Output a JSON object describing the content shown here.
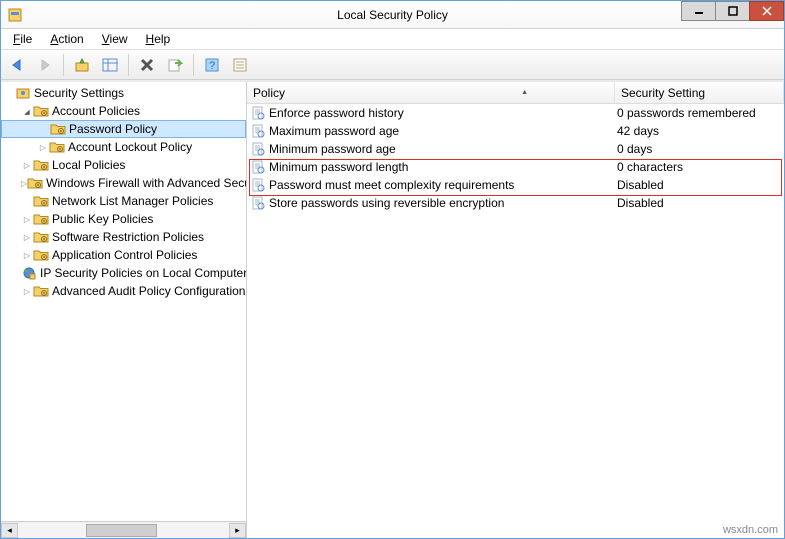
{
  "window": {
    "title": "Local Security Policy"
  },
  "menubar": {
    "file": "File",
    "action": "Action",
    "view": "View",
    "help": "Help"
  },
  "tree": {
    "root": "Security Settings",
    "items": [
      {
        "label": "Account Policies",
        "expander": "open",
        "indent": 1,
        "icon": "folder"
      },
      {
        "label": "Password Policy",
        "expander": "none",
        "indent": 2,
        "icon": "folder",
        "selected": true
      },
      {
        "label": "Account Lockout Policy",
        "expander": "closed",
        "indent": 2,
        "icon": "folder"
      },
      {
        "label": "Local Policies",
        "expander": "closed",
        "indent": 1,
        "icon": "folder"
      },
      {
        "label": "Windows Firewall with Advanced Security",
        "expander": "closed",
        "indent": 1,
        "icon": "folder"
      },
      {
        "label": "Network List Manager Policies",
        "expander": "none",
        "indent": 1,
        "icon": "folder"
      },
      {
        "label": "Public Key Policies",
        "expander": "closed",
        "indent": 1,
        "icon": "folder"
      },
      {
        "label": "Software Restriction Policies",
        "expander": "closed",
        "indent": 1,
        "icon": "folder"
      },
      {
        "label": "Application Control Policies",
        "expander": "closed",
        "indent": 1,
        "icon": "folder"
      },
      {
        "label": "IP Security Policies on Local Computer",
        "expander": "none",
        "indent": 1,
        "icon": "ipsec"
      },
      {
        "label": "Advanced Audit Policy Configuration",
        "expander": "closed",
        "indent": 1,
        "icon": "folder"
      }
    ]
  },
  "list": {
    "header_policy": "Policy",
    "header_setting": "Security Setting",
    "rows": [
      {
        "policy": "Enforce password history",
        "setting": "0 passwords remembered",
        "hl": false
      },
      {
        "policy": "Maximum password age",
        "setting": "42 days",
        "hl": false
      },
      {
        "policy": "Minimum password age",
        "setting": "0 days",
        "hl": false
      },
      {
        "policy": "Minimum password length",
        "setting": "0 characters",
        "hl": true
      },
      {
        "policy": "Password must meet complexity requirements",
        "setting": "Disabled",
        "hl": true
      },
      {
        "policy": "Store passwords using reversible encryption",
        "setting": "Disabled",
        "hl": false
      }
    ]
  },
  "watermark": "wsxdn.com"
}
